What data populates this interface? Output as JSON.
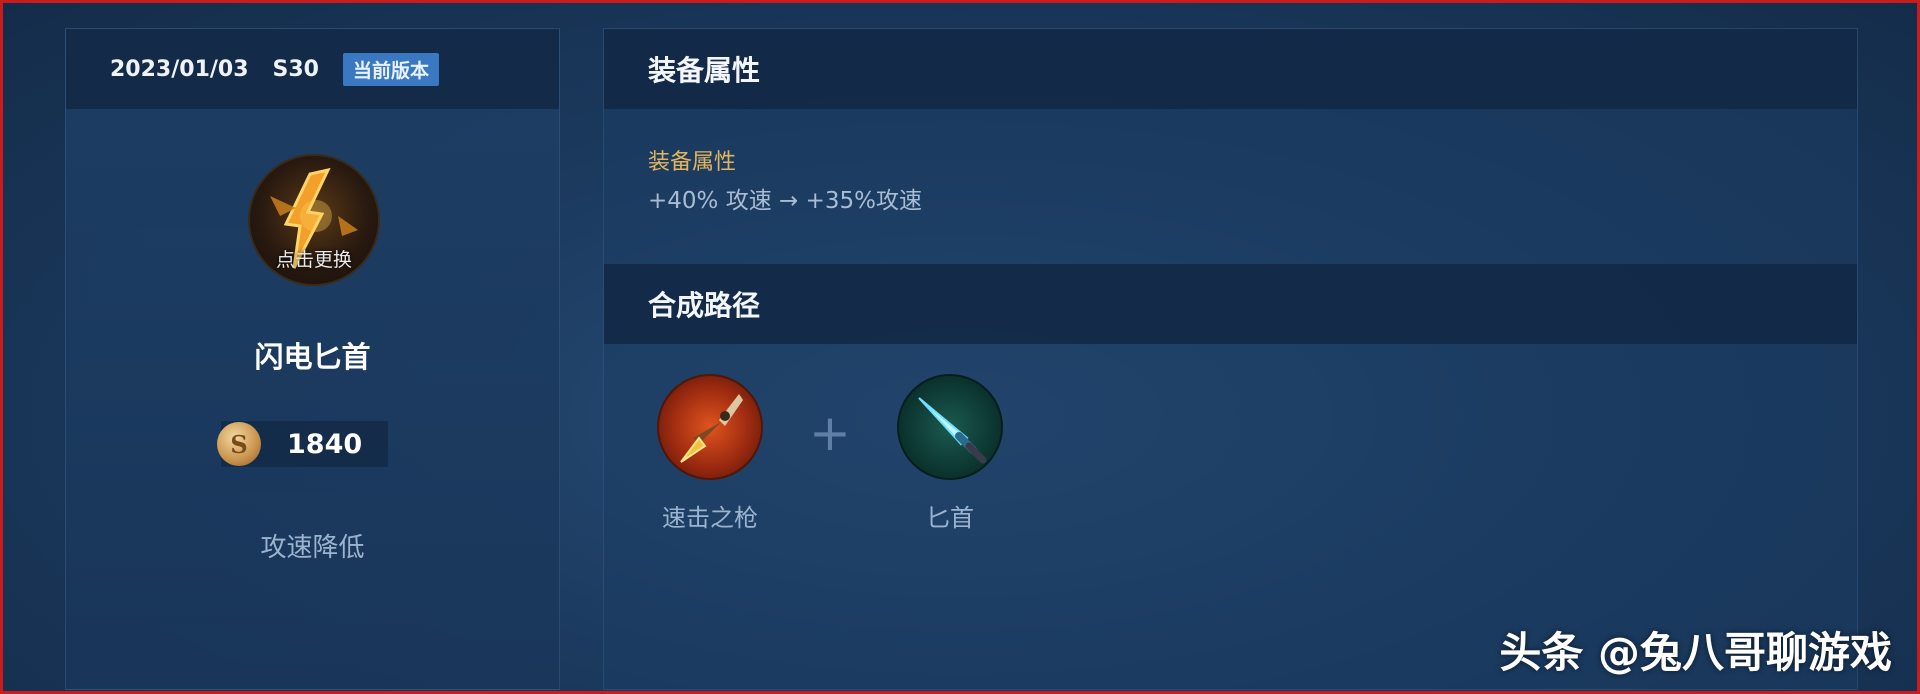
{
  "left_panel": {
    "date": "2023/01/03",
    "season": "S30",
    "version_badge": "当前版本",
    "item_icon": "lightning-dagger-icon",
    "change_label": "点击更换",
    "item_name": "闪电匕首",
    "price_icon": "gold-coin-icon",
    "price": "1840",
    "change_effect": "攻速降低"
  },
  "right_panel": {
    "attributes_header": "装备属性",
    "attributes": {
      "title": "装备属性",
      "value": "+40% 攻速 → +35%攻速"
    },
    "recipe_header": "合成路径",
    "recipe": [
      {
        "icon": "spear-icon",
        "label": "速击之枪"
      },
      {
        "icon": "dagger-icon",
        "label": "匕首"
      }
    ],
    "plus_symbol": "+"
  },
  "watermark": "头条 @兔八哥聊游戏",
  "colors": {
    "accent_gold": "#e3b45a",
    "badge_blue": "#3a78c2",
    "frame_red": "#c91d1d"
  }
}
